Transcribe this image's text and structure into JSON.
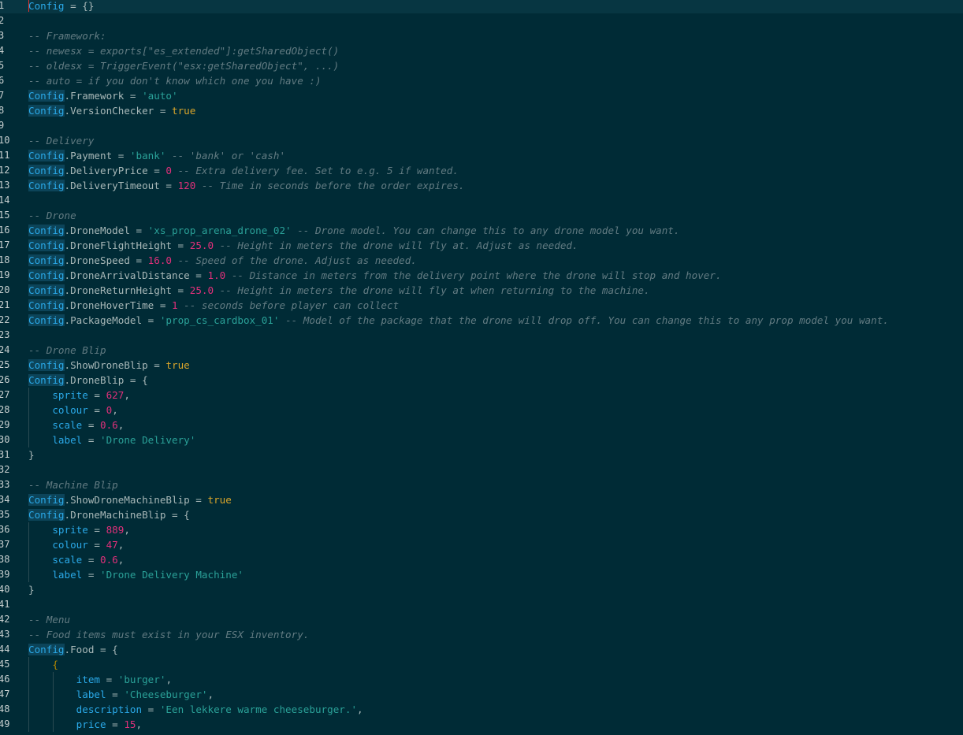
{
  "editor": {
    "lines": [
      {
        "n": "1",
        "s": [
          {
            "t": "Config",
            "c": "var"
          },
          {
            "t": " = {}",
            "c": "op"
          }
        ]
      },
      {
        "n": "2",
        "s": []
      },
      {
        "n": "3",
        "s": [
          {
            "t": "-- Framework:",
            "c": "cmt"
          }
        ]
      },
      {
        "n": "4",
        "s": [
          {
            "t": "-- newesx = exports[\"es_extended\"]:getSharedObject()",
            "c": "cmt"
          }
        ]
      },
      {
        "n": "5",
        "s": [
          {
            "t": "-- oldesx = TriggerEvent(\"esx:getSharedObject\", ...)",
            "c": "cmt"
          }
        ]
      },
      {
        "n": "6",
        "s": [
          {
            "t": "-- auto = if you don't know which one you have :)",
            "c": "cmt"
          }
        ]
      },
      {
        "n": "7",
        "s": [
          {
            "t": "Config",
            "c": "cfg"
          },
          {
            "t": ".Framework = ",
            "c": "op"
          },
          {
            "t": "'auto'",
            "c": "str"
          }
        ]
      },
      {
        "n": "8",
        "s": [
          {
            "t": "Config",
            "c": "cfg"
          },
          {
            "t": ".VersionChecker = ",
            "c": "op"
          },
          {
            "t": "true",
            "c": "bool"
          }
        ]
      },
      {
        "n": "9",
        "s": []
      },
      {
        "n": "10",
        "s": [
          {
            "t": "-- Delivery",
            "c": "cmt"
          }
        ]
      },
      {
        "n": "11",
        "s": [
          {
            "t": "Config",
            "c": "cfg"
          },
          {
            "t": ".Payment = ",
            "c": "op"
          },
          {
            "t": "'bank'",
            "c": "str"
          },
          {
            "t": " -- 'bank' or 'cash'",
            "c": "cmt"
          }
        ]
      },
      {
        "n": "12",
        "s": [
          {
            "t": "Config",
            "c": "cfg"
          },
          {
            "t": ".DeliveryPrice = ",
            "c": "op"
          },
          {
            "t": "0",
            "c": "num"
          },
          {
            "t": " -- Extra delivery fee. Set to e.g. 5 if wanted.",
            "c": "cmt"
          }
        ]
      },
      {
        "n": "13",
        "s": [
          {
            "t": "Config",
            "c": "cfg"
          },
          {
            "t": ".DeliveryTimeout = ",
            "c": "op"
          },
          {
            "t": "120",
            "c": "num"
          },
          {
            "t": " -- Time in seconds before the order expires.",
            "c": "cmt"
          }
        ]
      },
      {
        "n": "14",
        "s": []
      },
      {
        "n": "15",
        "s": [
          {
            "t": "-- Drone",
            "c": "cmt"
          }
        ]
      },
      {
        "n": "16",
        "s": [
          {
            "t": "Config",
            "c": "cfg"
          },
          {
            "t": ".DroneModel = ",
            "c": "op"
          },
          {
            "t": "'xs_prop_arena_drone_02'",
            "c": "str"
          },
          {
            "t": " -- Drone model. You can change this to any drone model you want.",
            "c": "cmt"
          }
        ]
      },
      {
        "n": "17",
        "s": [
          {
            "t": "Config",
            "c": "cfg"
          },
          {
            "t": ".DroneFlightHeight = ",
            "c": "op"
          },
          {
            "t": "25.0",
            "c": "num"
          },
          {
            "t": " -- Height in meters the drone will fly at. Adjust as needed.",
            "c": "cmt"
          }
        ]
      },
      {
        "n": "18",
        "s": [
          {
            "t": "Config",
            "c": "cfg"
          },
          {
            "t": ".DroneSpeed = ",
            "c": "op"
          },
          {
            "t": "16.0",
            "c": "num"
          },
          {
            "t": " -- Speed of the drone. Adjust as needed.",
            "c": "cmt"
          }
        ]
      },
      {
        "n": "19",
        "s": [
          {
            "t": "Config",
            "c": "cfg"
          },
          {
            "t": ".DroneArrivalDistance = ",
            "c": "op"
          },
          {
            "t": "1.0",
            "c": "num"
          },
          {
            "t": " -- Distance in meters from the delivery point where the drone will stop and hover.",
            "c": "cmt"
          }
        ]
      },
      {
        "n": "20",
        "s": [
          {
            "t": "Config",
            "c": "cfg"
          },
          {
            "t": ".DroneReturnHeight = ",
            "c": "op"
          },
          {
            "t": "25.0",
            "c": "num"
          },
          {
            "t": " -- Height in meters the drone will fly at when returning to the machine.",
            "c": "cmt"
          }
        ]
      },
      {
        "n": "21",
        "s": [
          {
            "t": "Config",
            "c": "cfg"
          },
          {
            "t": ".DroneHoverTime = ",
            "c": "op"
          },
          {
            "t": "1",
            "c": "num"
          },
          {
            "t": " -- seconds before player can collect",
            "c": "cmt"
          }
        ]
      },
      {
        "n": "22",
        "s": [
          {
            "t": "Config",
            "c": "cfg"
          },
          {
            "t": ".PackageModel = ",
            "c": "op"
          },
          {
            "t": "'prop_cs_cardbox_01'",
            "c": "str"
          },
          {
            "t": " -- Model of the package that the drone will drop off. You can change this to any prop model you want.",
            "c": "cmt"
          }
        ]
      },
      {
        "n": "23",
        "s": []
      },
      {
        "n": "24",
        "s": [
          {
            "t": "-- Drone Blip",
            "c": "cmt"
          }
        ]
      },
      {
        "n": "25",
        "s": [
          {
            "t": "Config",
            "c": "cfg"
          },
          {
            "t": ".ShowDroneBlip = ",
            "c": "op"
          },
          {
            "t": "true",
            "c": "bool"
          }
        ]
      },
      {
        "n": "26",
        "s": [
          {
            "t": "Config",
            "c": "cfg"
          },
          {
            "t": ".DroneBlip = {",
            "c": "op"
          }
        ]
      },
      {
        "n": "27",
        "s": [
          {
            "t": "    ",
            "c": "op"
          },
          {
            "t": "sprite",
            "c": "key"
          },
          {
            "t": " = ",
            "c": "op"
          },
          {
            "t": "627",
            "c": "num"
          },
          {
            "t": ",",
            "c": "op"
          }
        ]
      },
      {
        "n": "28",
        "s": [
          {
            "t": "    ",
            "c": "op"
          },
          {
            "t": "colour",
            "c": "key"
          },
          {
            "t": " = ",
            "c": "op"
          },
          {
            "t": "0",
            "c": "num"
          },
          {
            "t": ",",
            "c": "op"
          }
        ]
      },
      {
        "n": "29",
        "s": [
          {
            "t": "    ",
            "c": "op"
          },
          {
            "t": "scale",
            "c": "key"
          },
          {
            "t": " = ",
            "c": "op"
          },
          {
            "t": "0.6",
            "c": "num"
          },
          {
            "t": ",",
            "c": "op"
          }
        ]
      },
      {
        "n": "30",
        "s": [
          {
            "t": "    ",
            "c": "op"
          },
          {
            "t": "label",
            "c": "key"
          },
          {
            "t": " = ",
            "c": "op"
          },
          {
            "t": "'Drone Delivery'",
            "c": "str"
          }
        ]
      },
      {
        "n": "31",
        "s": [
          {
            "t": "}",
            "c": "op"
          }
        ]
      },
      {
        "n": "32",
        "s": []
      },
      {
        "n": "33",
        "s": [
          {
            "t": "-- Machine Blip",
            "c": "cmt"
          }
        ]
      },
      {
        "n": "34",
        "s": [
          {
            "t": "Config",
            "c": "cfg"
          },
          {
            "t": ".ShowDroneMachineBlip = ",
            "c": "op"
          },
          {
            "t": "true",
            "c": "bool"
          }
        ]
      },
      {
        "n": "35",
        "s": [
          {
            "t": "Config",
            "c": "cfg"
          },
          {
            "t": ".DroneMachineBlip = {",
            "c": "op"
          }
        ]
      },
      {
        "n": "36",
        "s": [
          {
            "t": "    ",
            "c": "op"
          },
          {
            "t": "sprite",
            "c": "key"
          },
          {
            "t": " = ",
            "c": "op"
          },
          {
            "t": "889",
            "c": "num"
          },
          {
            "t": ",",
            "c": "op"
          }
        ]
      },
      {
        "n": "37",
        "s": [
          {
            "t": "    ",
            "c": "op"
          },
          {
            "t": "colour",
            "c": "key"
          },
          {
            "t": " = ",
            "c": "op"
          },
          {
            "t": "47",
            "c": "num"
          },
          {
            "t": ",",
            "c": "op"
          }
        ]
      },
      {
        "n": "38",
        "s": [
          {
            "t": "    ",
            "c": "op"
          },
          {
            "t": "scale",
            "c": "key"
          },
          {
            "t": " = ",
            "c": "op"
          },
          {
            "t": "0.6",
            "c": "num"
          },
          {
            "t": ",",
            "c": "op"
          }
        ]
      },
      {
        "n": "39",
        "s": [
          {
            "t": "    ",
            "c": "op"
          },
          {
            "t": "label",
            "c": "key"
          },
          {
            "t": " = ",
            "c": "op"
          },
          {
            "t": "'Drone Delivery Machine'",
            "c": "str"
          }
        ]
      },
      {
        "n": "40",
        "s": [
          {
            "t": "}",
            "c": "op"
          }
        ]
      },
      {
        "n": "41",
        "s": []
      },
      {
        "n": "42",
        "s": [
          {
            "t": "-- Menu",
            "c": "cmt"
          }
        ]
      },
      {
        "n": "43",
        "s": [
          {
            "t": "-- Food items must exist in your ESX inventory.",
            "c": "cmt"
          }
        ]
      },
      {
        "n": "44",
        "s": [
          {
            "t": "Config",
            "c": "cfg"
          },
          {
            "t": ".Food = {",
            "c": "op"
          }
        ]
      },
      {
        "n": "45",
        "s": [
          {
            "t": "    ",
            "c": "op"
          },
          {
            "t": "{",
            "c": "brace2"
          }
        ]
      },
      {
        "n": "46",
        "s": [
          {
            "t": "        ",
            "c": "op"
          },
          {
            "t": "item",
            "c": "key"
          },
          {
            "t": " = ",
            "c": "op"
          },
          {
            "t": "'burger'",
            "c": "str"
          },
          {
            "t": ",",
            "c": "op"
          }
        ]
      },
      {
        "n": "47",
        "s": [
          {
            "t": "        ",
            "c": "op"
          },
          {
            "t": "label",
            "c": "key"
          },
          {
            "t": " = ",
            "c": "op"
          },
          {
            "t": "'Cheeseburger'",
            "c": "str"
          },
          {
            "t": ",",
            "c": "op"
          }
        ]
      },
      {
        "n": "48",
        "s": [
          {
            "t": "        ",
            "c": "op"
          },
          {
            "t": "description",
            "c": "key"
          },
          {
            "t": " = ",
            "c": "op"
          },
          {
            "t": "'Een lekkere warme cheeseburger.'",
            "c": "str"
          },
          {
            "t": ",",
            "c": "op"
          }
        ]
      },
      {
        "n": "49",
        "s": [
          {
            "t": "        ",
            "c": "op"
          },
          {
            "t": "price",
            "c": "key"
          },
          {
            "t": " = ",
            "c": "op"
          },
          {
            "t": "15",
            "c": "num"
          },
          {
            "t": ",",
            "c": "op"
          }
        ]
      }
    ],
    "colors": {
      "background": "#002b36",
      "current_line": "#073642",
      "identifier": "#2aa9e8",
      "string": "#2aa198",
      "number": "#e0307a",
      "boolean": "#d9a52b",
      "comment": "#627b82",
      "cursor": "#dc322f"
    }
  }
}
